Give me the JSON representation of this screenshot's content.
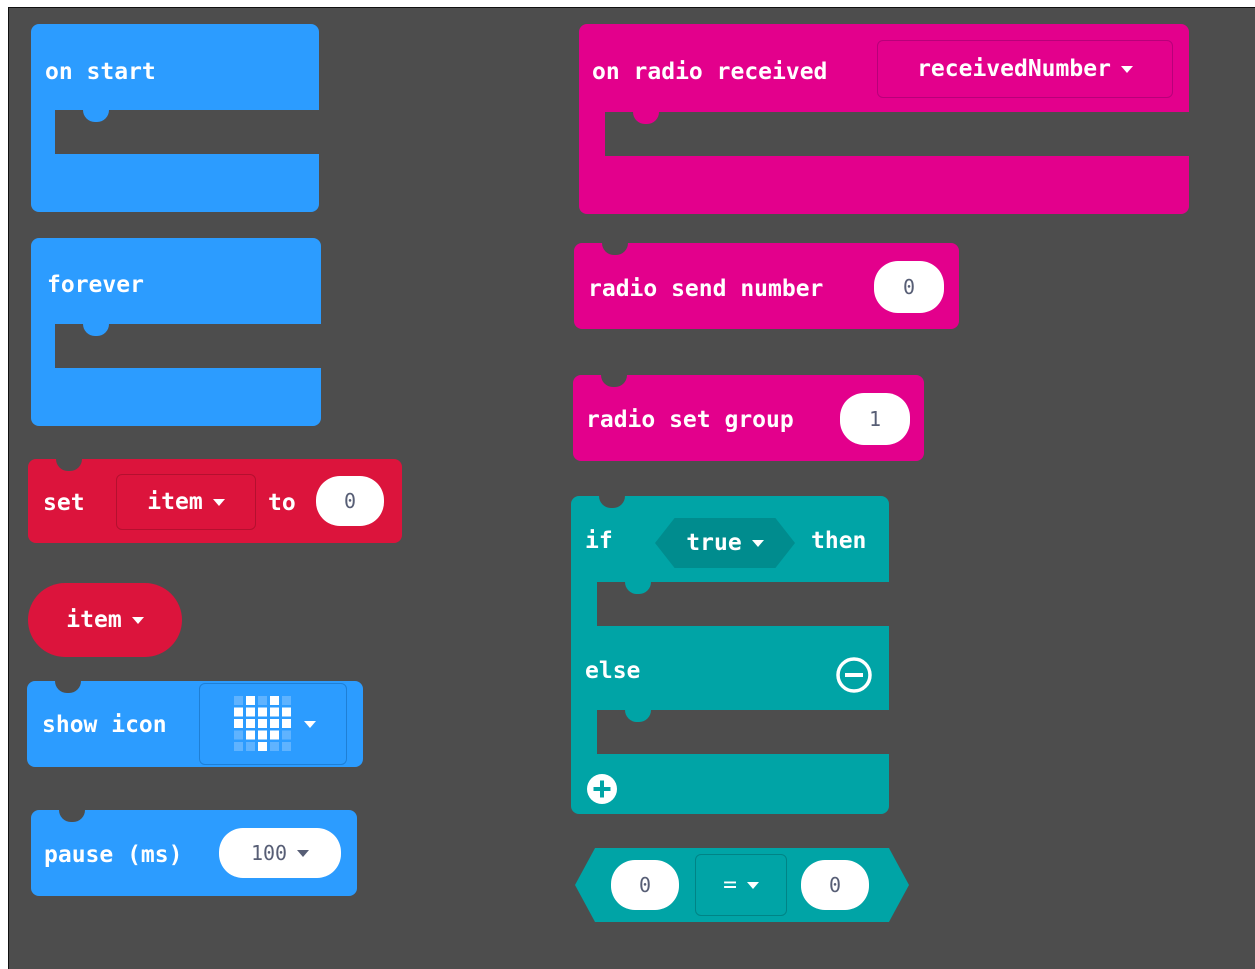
{
  "blocks": {
    "on_start": "on start",
    "forever": "forever",
    "set_var": {
      "set": "set",
      "var": "item",
      "to": "to",
      "value": "0"
    },
    "item_reporter": "item",
    "show_icon": "show icon",
    "pause": {
      "label": "pause (ms)",
      "value": "100"
    },
    "on_radio_received": {
      "label": "on radio received",
      "param": "receivedNumber"
    },
    "radio_send": {
      "label": "radio send number",
      "value": "0"
    },
    "radio_group": {
      "label": "radio set group",
      "value": "1"
    },
    "if_else": {
      "if": "if",
      "cond": "true",
      "then": "then",
      "else": "else"
    },
    "compare": {
      "left": "0",
      "op": "=",
      "right": "0"
    }
  },
  "colors": {
    "background": "#4d4d4d",
    "basic": "#2c9cff",
    "radio": "#e3008c",
    "variables": "#dc143c",
    "logic": "#00a4a6"
  },
  "icon": {
    "name": "heart-icon"
  }
}
